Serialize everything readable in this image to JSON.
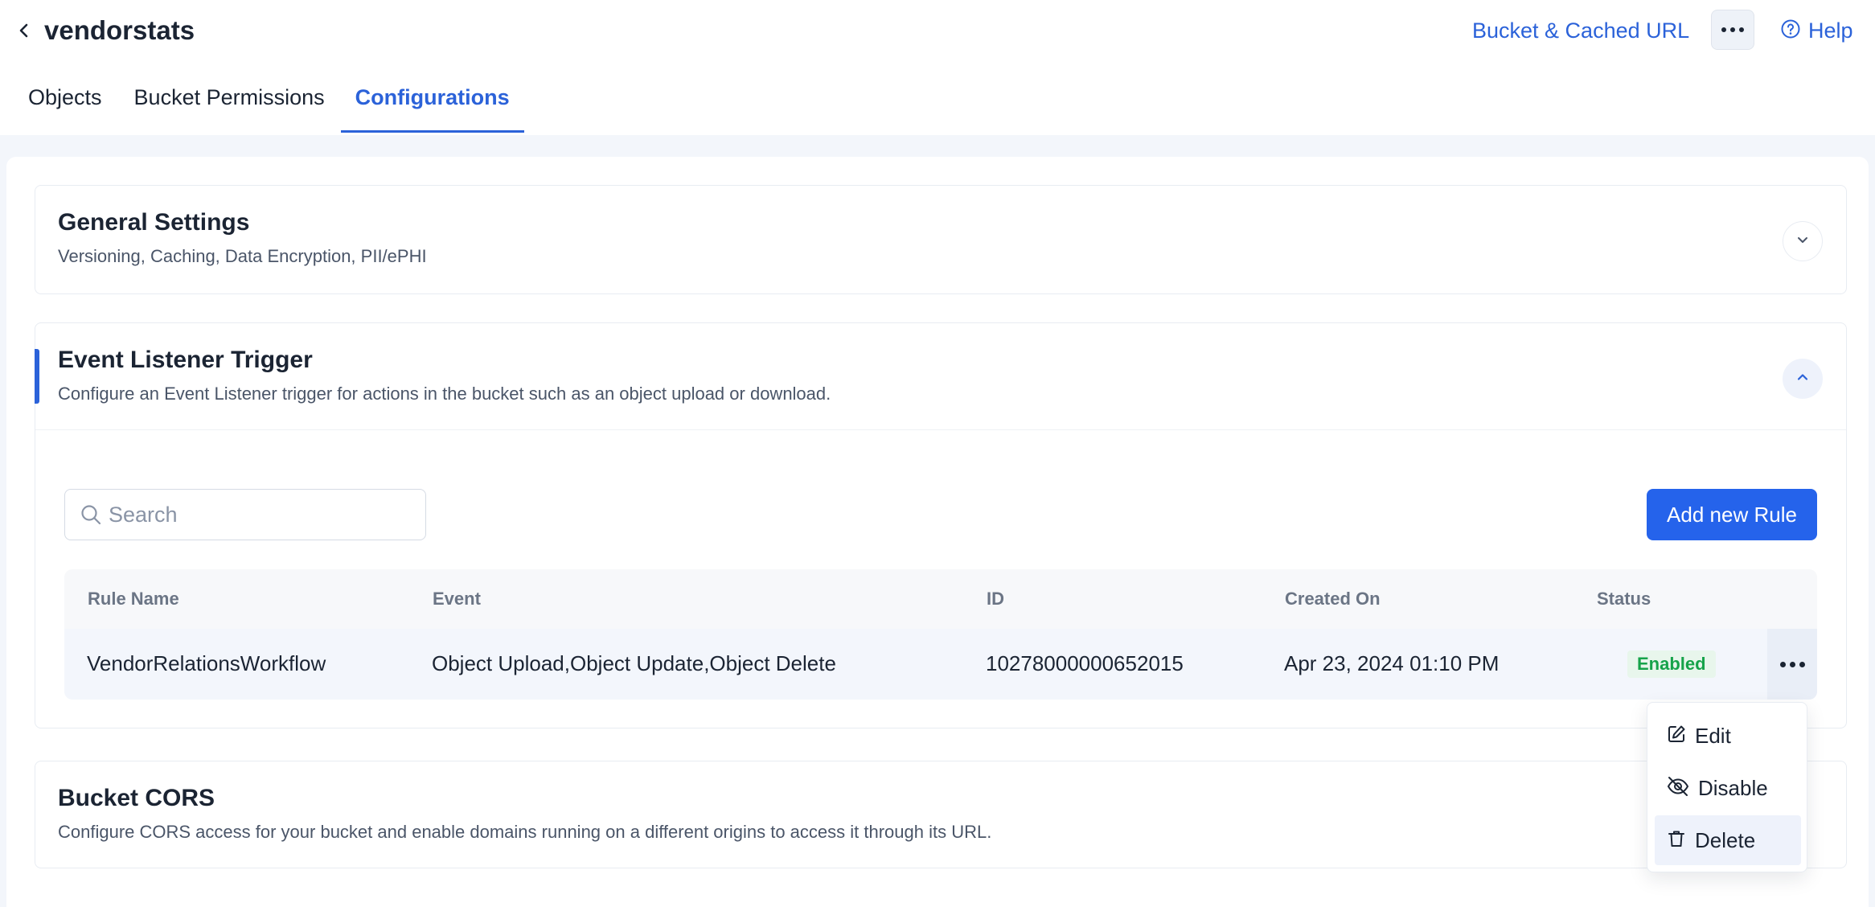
{
  "header": {
    "title": "vendorstats",
    "bucket_link": "Bucket & Cached URL",
    "help_label": "Help"
  },
  "tabs": [
    {
      "label": "Objects",
      "active": false
    },
    {
      "label": "Bucket Permissions",
      "active": false
    },
    {
      "label": "Configurations",
      "active": true
    }
  ],
  "sections": {
    "general": {
      "title": "General Settings",
      "subtitle": "Versioning, Caching, Data Encryption, PII/ePHI"
    },
    "event_listener": {
      "title": "Event Listener Trigger",
      "subtitle": "Configure an Event Listener trigger for actions in the bucket such as an object upload or download.",
      "search_placeholder": "Search",
      "add_button": "Add new Rule",
      "columns": [
        "Rule Name",
        "Event",
        "ID",
        "Created On",
        "Status"
      ],
      "rows": [
        {
          "rule_name": "VendorRelationsWorkflow",
          "event": "Object Upload,Object Update,Object Delete",
          "id": "10278000000652015",
          "created_on": "Apr 23, 2024 01:10 PM",
          "status": "Enabled"
        }
      ]
    },
    "cors": {
      "title": "Bucket CORS",
      "subtitle": "Configure CORS access for your bucket and enable domains running on a different origins to access it through its URL."
    }
  },
  "row_menu": {
    "items": [
      {
        "label": "Edit",
        "icon": "edit-icon"
      },
      {
        "label": "Disable",
        "icon": "eye-off-icon"
      },
      {
        "label": "Delete",
        "icon": "trash-icon"
      }
    ]
  },
  "colors": {
    "accent": "#2b62d9",
    "primary_button": "#2563eb",
    "status_enabled": "#16a34a",
    "status_enabled_bg": "#e8f6ec"
  }
}
